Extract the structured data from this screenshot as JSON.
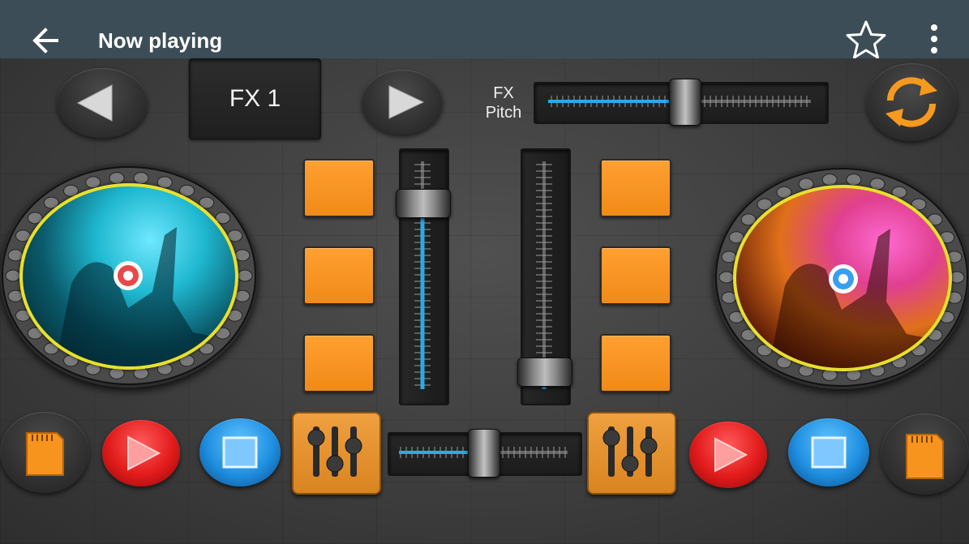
{
  "appbar": {
    "title": "Now playing",
    "background": "#3c4d57",
    "icons": [
      "back-arrow-icon",
      "star-outline-icon",
      "more-vert-icon"
    ]
  },
  "controls": {
    "fx_label": "FX 1",
    "pitch_label_line1": "FX",
    "pitch_label_line2": "Pitch",
    "fx_pitch_level": 0.52,
    "left_channel_level": 0.82,
    "right_channel_level": 0.08,
    "crossfader_level": 0.5
  },
  "colors": {
    "pad_orange": "#f7941d",
    "play_red": "#e21b1b",
    "stop_blue": "#1f8fe0",
    "slider_blue": "#2fa8e6",
    "turntable_ring": "#e8e02c",
    "sync_orange": "#f59a1f"
  },
  "icon_names": {
    "prev": "triangle-left-icon",
    "next": "triangle-right-icon",
    "sync": "sync-arrows-icon",
    "sd_card": "sd-card-icon",
    "play": "play-icon",
    "stop": "stop-square-icon",
    "mixer": "equalizer-sliders-icon"
  }
}
